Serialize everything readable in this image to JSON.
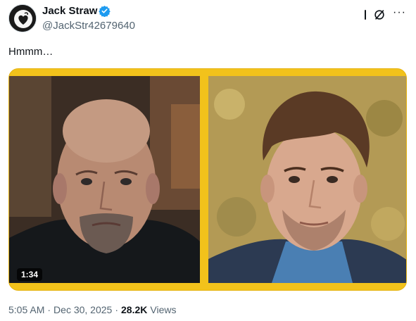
{
  "author": {
    "display_name": "Jack Straw",
    "handle": "@JackStr42679640",
    "verified": true,
    "avatar_icon": "heart-avatar-icon"
  },
  "tweet": {
    "text": "Hmmm…"
  },
  "media": {
    "video_duration": "1:34",
    "frame_color": "#f2c21b"
  },
  "meta": {
    "time": "5:05 AM",
    "separator": "·",
    "date": "Dec 30, 2025",
    "views_count": "28.2K",
    "views_label": "Views"
  },
  "actions": {
    "grok_icon": "grok-icon",
    "more_icon": "more-icon"
  },
  "colors": {
    "text_primary": "#0f1419",
    "text_secondary": "#536471",
    "verified_blue": "#1d9bf0"
  }
}
